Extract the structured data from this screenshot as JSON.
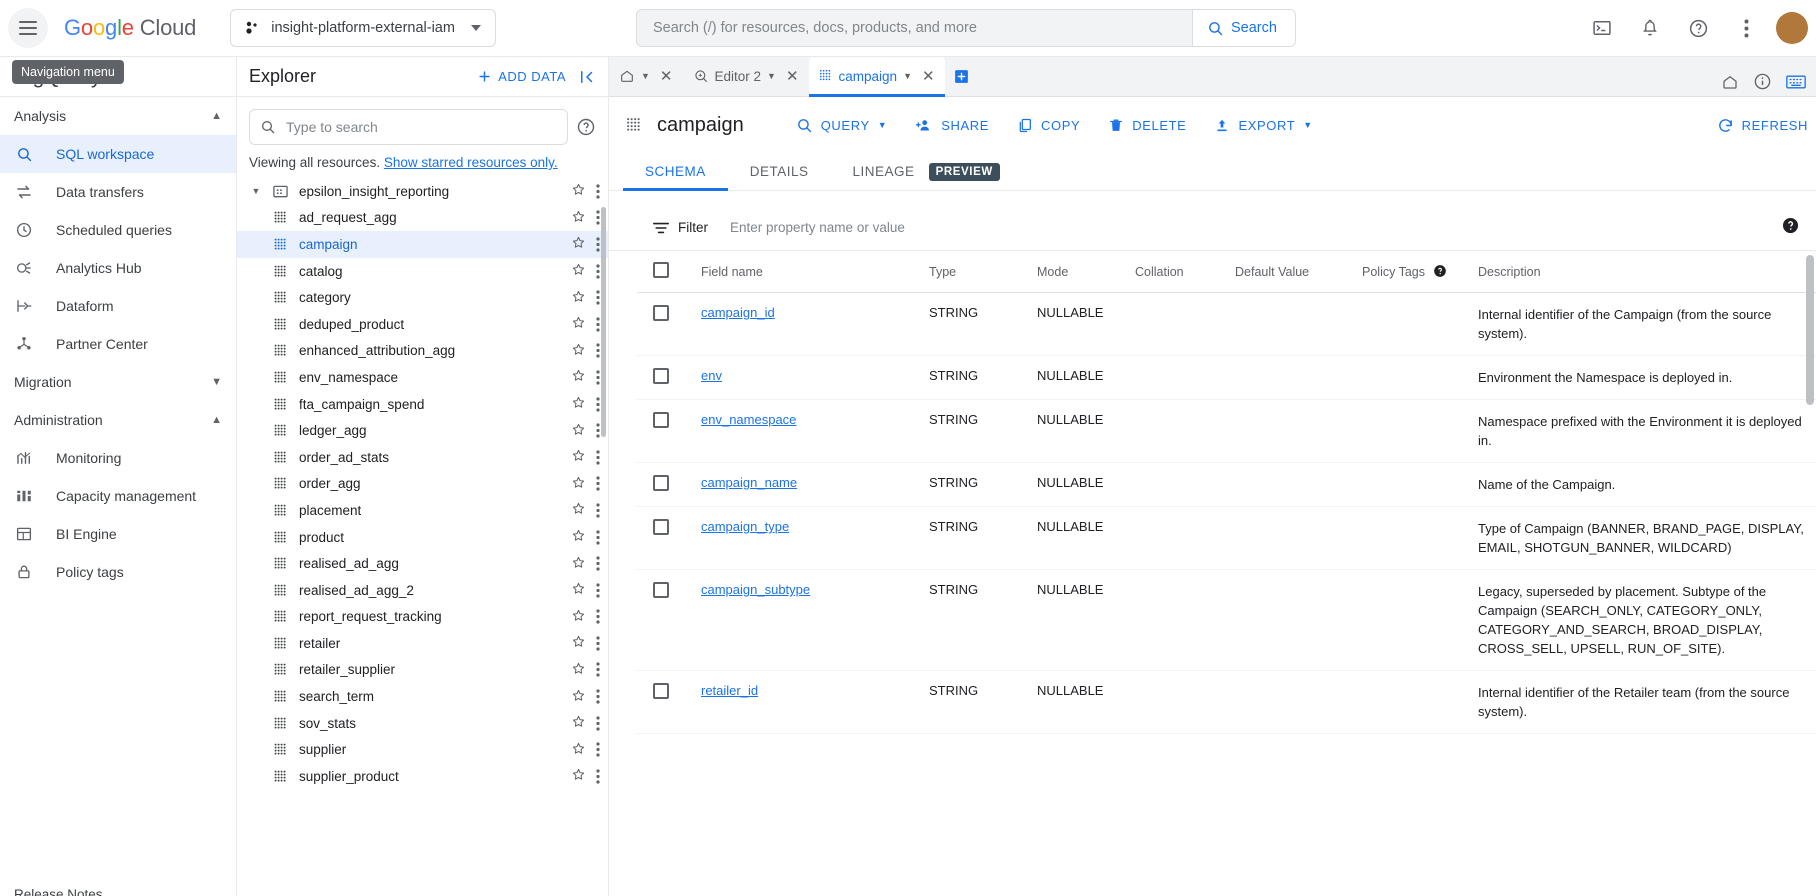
{
  "topbar": {
    "nav_tooltip": "Navigation menu",
    "logo_google": "Google",
    "logo_cloud": "Cloud",
    "project": "insight-platform-external-iam",
    "search_placeholder": "Search (/) for resources, docs, products, and more",
    "search_value": "",
    "search_button": "Search"
  },
  "leftnav": {
    "product_title": "BigQuery",
    "sections": [
      {
        "label": "Analysis",
        "expanded": true,
        "items": [
          {
            "label": "SQL workspace",
            "icon": "search-icon",
            "selected": true
          },
          {
            "label": "Data transfers",
            "icon": "transfer-icon",
            "selected": false
          },
          {
            "label": "Scheduled queries",
            "icon": "clock-icon",
            "selected": false
          },
          {
            "label": "Analytics Hub",
            "icon": "share-nodes-icon",
            "selected": false
          },
          {
            "label": "Dataform",
            "icon": "dataform-icon",
            "selected": false
          },
          {
            "label": "Partner Center",
            "icon": "partner-icon",
            "selected": false
          }
        ]
      },
      {
        "label": "Migration",
        "expanded": false,
        "items": []
      },
      {
        "label": "Administration",
        "expanded": true,
        "items": [
          {
            "label": "Monitoring",
            "icon": "monitoring-icon",
            "selected": false
          },
          {
            "label": "Capacity management",
            "icon": "capacity-icon",
            "selected": false
          },
          {
            "label": "BI Engine",
            "icon": "bi-engine-icon",
            "selected": false
          },
          {
            "label": "Policy tags",
            "icon": "lock-icon",
            "selected": false
          }
        ]
      }
    ],
    "release_notes": "Release Notes"
  },
  "explorer": {
    "title": "Explorer",
    "add_data": "ADD DATA",
    "search_placeholder": "Type to search",
    "search_value": "",
    "viewing_text": "Viewing all resources.",
    "viewing_link": "Show starred resources only.",
    "tree": [
      {
        "label": "epsilon_insight_reporting",
        "type": "dataset",
        "expanded": true,
        "selected": false
      },
      {
        "label": "ad_request_agg",
        "type": "table",
        "selected": false
      },
      {
        "label": "campaign",
        "type": "table",
        "selected": true
      },
      {
        "label": "catalog",
        "type": "table",
        "selected": false
      },
      {
        "label": "category",
        "type": "table",
        "selected": false
      },
      {
        "label": "deduped_product",
        "type": "table",
        "selected": false
      },
      {
        "label": "enhanced_attribution_agg",
        "type": "table",
        "selected": false
      },
      {
        "label": "env_namespace",
        "type": "table",
        "selected": false
      },
      {
        "label": "fta_campaign_spend",
        "type": "table",
        "selected": false
      },
      {
        "label": "ledger_agg",
        "type": "table",
        "selected": false
      },
      {
        "label": "order_ad_stats",
        "type": "table",
        "selected": false
      },
      {
        "label": "order_agg",
        "type": "table",
        "selected": false
      },
      {
        "label": "placement",
        "type": "table",
        "selected": false
      },
      {
        "label": "product",
        "type": "table",
        "selected": false
      },
      {
        "label": "realised_ad_agg",
        "type": "table",
        "selected": false
      },
      {
        "label": "realised_ad_agg_2",
        "type": "table",
        "selected": false
      },
      {
        "label": "report_request_tracking",
        "type": "table",
        "selected": false
      },
      {
        "label": "retailer",
        "type": "table",
        "selected": false
      },
      {
        "label": "retailer_supplier",
        "type": "table",
        "selected": false
      },
      {
        "label": "search_term",
        "type": "table",
        "selected": false
      },
      {
        "label": "sov_stats",
        "type": "table",
        "selected": false
      },
      {
        "label": "supplier",
        "type": "table",
        "selected": false
      },
      {
        "label": "supplier_product",
        "type": "table",
        "selected": false
      }
    ]
  },
  "tabs": [
    {
      "label": "",
      "icon": "home-icon",
      "has_dropdown": true,
      "closeable": true,
      "active": false
    },
    {
      "label": "Editor 2",
      "icon": "query-icon",
      "has_dropdown": true,
      "closeable": true,
      "active": false
    },
    {
      "label": "campaign",
      "icon": "table-icon",
      "has_dropdown": true,
      "closeable": true,
      "active": true
    }
  ],
  "tabs_new_label": "+",
  "toolbar": {
    "table_name": "campaign",
    "buttons": [
      {
        "label": "QUERY",
        "icon": "search-icon",
        "dropdown": true
      },
      {
        "label": "SHARE",
        "icon": "person-add-icon",
        "dropdown": false
      },
      {
        "label": "COPY",
        "icon": "copy-icon",
        "dropdown": false
      },
      {
        "label": "DELETE",
        "icon": "trash-icon",
        "dropdown": false
      },
      {
        "label": "EXPORT",
        "icon": "upload-icon",
        "dropdown": true
      }
    ],
    "refresh_label": "REFRESH"
  },
  "subtabs": [
    {
      "label": "SCHEMA",
      "active": true
    },
    {
      "label": "DETAILS",
      "active": false
    },
    {
      "label": "LINEAGE",
      "active": false
    }
  ],
  "preview_chip": "PREVIEW",
  "filter": {
    "label": "Filter",
    "placeholder": "Enter property name or value",
    "value": ""
  },
  "schema": {
    "columns": [
      "Field name",
      "Type",
      "Mode",
      "Collation",
      "Default Value",
      "Policy Tags",
      "Description"
    ],
    "rows": [
      {
        "field": "campaign_id",
        "type": "STRING",
        "mode": "NULLABLE",
        "collation": "",
        "default": "",
        "policy_tags": "",
        "description": "Internal identifier of the Campaign (from the source system)."
      },
      {
        "field": "env",
        "type": "STRING",
        "mode": "NULLABLE",
        "collation": "",
        "default": "",
        "policy_tags": "",
        "description": "Environment the Namespace is deployed in."
      },
      {
        "field": "env_namespace",
        "type": "STRING",
        "mode": "NULLABLE",
        "collation": "",
        "default": "",
        "policy_tags": "",
        "description": "Namespace prefixed with the Environment it is deployed in."
      },
      {
        "field": "campaign_name",
        "type": "STRING",
        "mode": "NULLABLE",
        "collation": "",
        "default": "",
        "policy_tags": "",
        "description": "Name of the Campaign."
      },
      {
        "field": "campaign_type",
        "type": "STRING",
        "mode": "NULLABLE",
        "collation": "",
        "default": "",
        "policy_tags": "",
        "description": "Type of Campaign (BANNER, BRAND_PAGE, DISPLAY, EMAIL, SHOTGUN_BANNER, WILDCARD)"
      },
      {
        "field": "campaign_subtype",
        "type": "STRING",
        "mode": "NULLABLE",
        "collation": "",
        "default": "",
        "policy_tags": "",
        "description": "Legacy, superseded by placement. Subtype of the Campaign (SEARCH_ONLY, CATEGORY_ONLY, CATEGORY_AND_SEARCH, BROAD_DISPLAY, CROSS_SELL, UPSELL, RUN_OF_SITE)."
      },
      {
        "field": "retailer_id",
        "type": "STRING",
        "mode": "NULLABLE",
        "collation": "",
        "default": "",
        "policy_tags": "",
        "description": "Internal identifier of the Retailer team (from the source system)."
      }
    ]
  },
  "colors": {
    "accent": "#1a73e8",
    "selected_row_bg": "#e8f0fe",
    "chip_bg": "#3c4e5c",
    "toolbar_bg": "#f1f3f4"
  }
}
